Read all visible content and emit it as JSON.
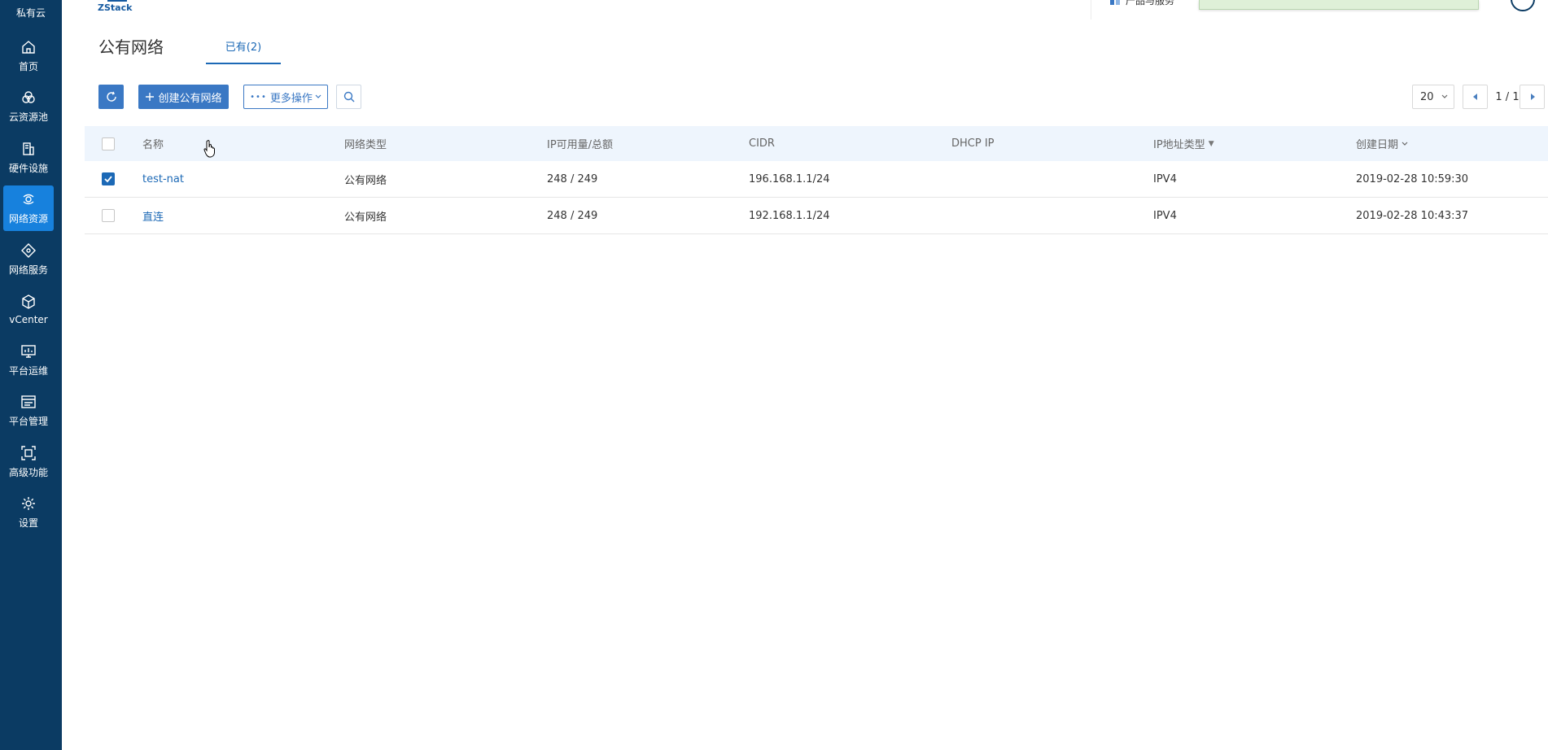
{
  "sidebar": {
    "top_label": "私有云",
    "items": [
      {
        "label": "首页",
        "icon": "home-icon"
      },
      {
        "label": "云资源池",
        "icon": "cloud-resources-icon"
      },
      {
        "label": "硬件设施",
        "icon": "hardware-icon"
      },
      {
        "label": "网络资源",
        "icon": "network-resources-icon",
        "active": true
      },
      {
        "label": "网络服务",
        "icon": "network-service-icon"
      },
      {
        "label": "vCenter",
        "icon": "cube-icon"
      },
      {
        "label": "平台运维",
        "icon": "monitor-icon"
      },
      {
        "label": "平台管理",
        "icon": "platform-management-icon"
      },
      {
        "label": "高级功能",
        "icon": "advanced-icon"
      },
      {
        "label": "设置",
        "icon": "gear-icon"
      }
    ]
  },
  "header": {
    "logo_text": "ZStack",
    "service_label": "产品与服务"
  },
  "page": {
    "title": "公有网络",
    "tab_existing": "已有(2)"
  },
  "toolbar": {
    "create_label": "创建公有网络",
    "more_label": "更多操作"
  },
  "pagination": {
    "page_size": "20",
    "page_info": "1 / 1"
  },
  "table": {
    "columns": [
      "名称",
      "网络类型",
      "IP可用量/总额",
      "CIDR",
      "DHCP IP",
      "IP地址类型",
      "创建日期"
    ],
    "rows": [
      {
        "checked": true,
        "name": "test-nat",
        "type": "公有网络",
        "ip_usage": "248 / 249",
        "cidr": "196.168.1.1/24",
        "dhcp": "",
        "ip_type": "IPV4",
        "created": "2019-02-28 10:59:30"
      },
      {
        "checked": false,
        "name": "直连",
        "type": "公有网络",
        "ip_usage": "248 / 249",
        "cidr": "192.168.1.1/24",
        "dhcp": "",
        "ip_type": "IPV4",
        "created": "2019-02-28 10:43:37"
      }
    ]
  },
  "colors": {
    "sidebar_bg": "#0b3b63",
    "active_bg": "#1781dd",
    "accent": "#1c69b6",
    "header_row_bg": "#eef5fd"
  }
}
